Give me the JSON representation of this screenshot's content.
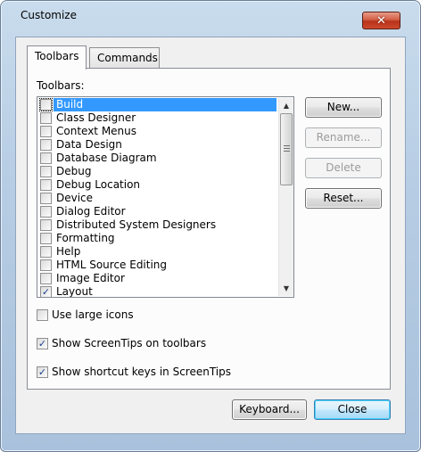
{
  "window": {
    "title": "Customize",
    "close_glyph": "✕"
  },
  "tabs": [
    {
      "label": "Toolbars",
      "active": true
    },
    {
      "label": "Commands",
      "active": false
    }
  ],
  "toolbars_label": "Toolbars:",
  "toolbar_list": [
    {
      "label": "Build",
      "checked": false,
      "selected": true
    },
    {
      "label": "Class Designer",
      "checked": false
    },
    {
      "label": "Context Menus",
      "checked": false
    },
    {
      "label": "Data Design",
      "checked": false
    },
    {
      "label": "Database Diagram",
      "checked": false
    },
    {
      "label": "Debug",
      "checked": false
    },
    {
      "label": "Debug Location",
      "checked": false
    },
    {
      "label": "Device",
      "checked": false
    },
    {
      "label": "Dialog Editor",
      "checked": false
    },
    {
      "label": "Distributed System Designers",
      "checked": false
    },
    {
      "label": "Formatting",
      "checked": false
    },
    {
      "label": "Help",
      "checked": false
    },
    {
      "label": "HTML Source Editing",
      "checked": false
    },
    {
      "label": "Image Editor",
      "checked": false
    },
    {
      "label": "Layout",
      "checked": true
    }
  ],
  "side_buttons": {
    "new": "New...",
    "rename": "Rename...",
    "delete": "Delete",
    "reset": "Reset..."
  },
  "options": {
    "large_icons": {
      "label": "Use large icons",
      "checked": false
    },
    "screentips": {
      "label": "Show ScreenTips on toolbars",
      "checked": true
    },
    "shortcut_keys": {
      "label": "Show shortcut keys in ScreenTips",
      "checked": true
    }
  },
  "footer": {
    "keyboard": "Keyboard...",
    "close": "Close"
  },
  "check_glyph": "✓",
  "scroll_up_glyph": "▲",
  "scroll_down_glyph": "▼"
}
